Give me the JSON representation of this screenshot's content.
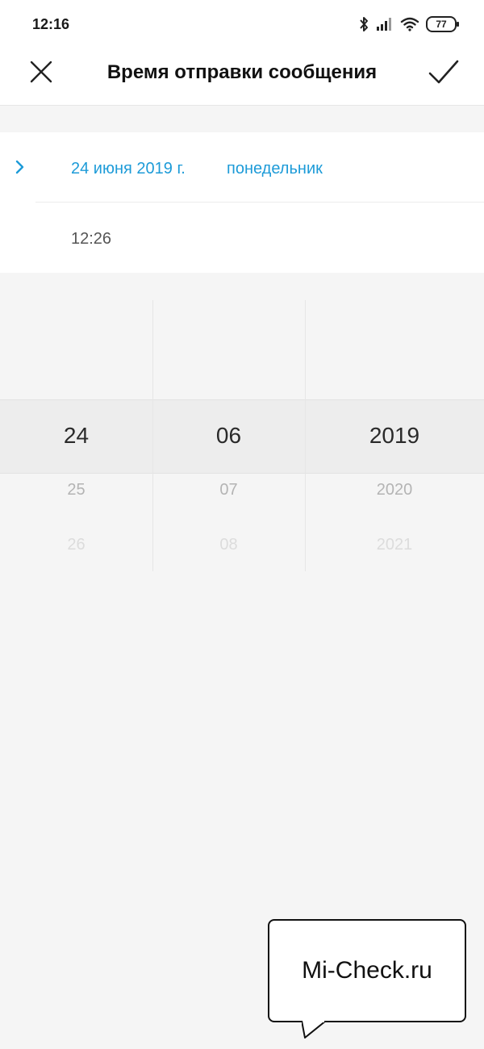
{
  "status_bar": {
    "time": "12:16",
    "battery": "77",
    "icons": [
      "bluetooth-icon",
      "signal-icon",
      "wifi-icon",
      "battery-icon"
    ]
  },
  "title_bar": {
    "title": "Время отправки сообщения",
    "close_icon": "close-icon",
    "confirm_icon": "check-icon"
  },
  "schedule": {
    "date": "24 июня 2019 г.",
    "weekday": "понедельник",
    "time": "12:26"
  },
  "picker": {
    "day": {
      "selected": "24",
      "next": [
        "25",
        "26"
      ]
    },
    "month": {
      "selected": "06",
      "next": [
        "07",
        "08"
      ]
    },
    "year": {
      "selected": "2019",
      "next": [
        "2020",
        "2021"
      ]
    }
  },
  "watermark": {
    "text": "Mi-Check.ru"
  },
  "colors": {
    "accent": "#1d9bd8",
    "background": "#f5f5f5"
  }
}
